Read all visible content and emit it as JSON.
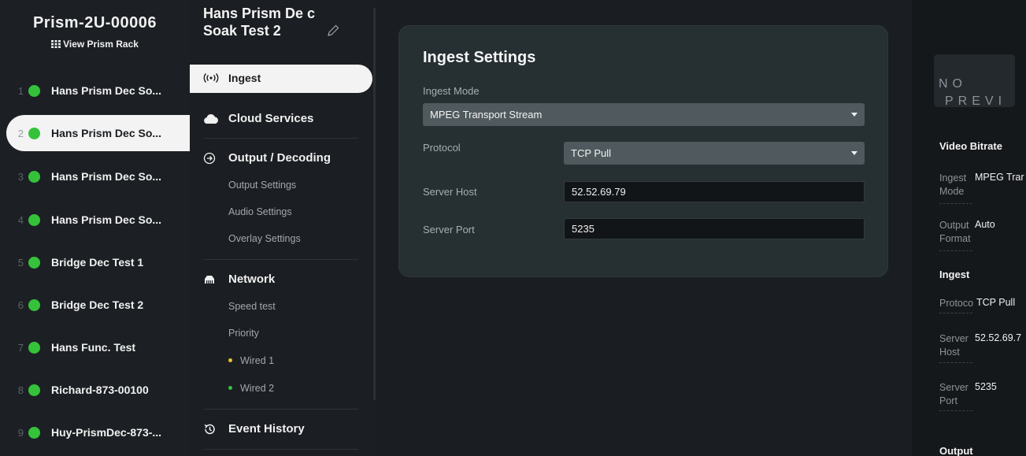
{
  "rack": {
    "title": "Prism-2U-00006",
    "view_link": "View Prism Rack",
    "devices": [
      {
        "num": "1",
        "name": "Hans Prism Dec So...",
        "active": false
      },
      {
        "num": "2",
        "name": "Hans Prism Dec So...",
        "active": true
      },
      {
        "num": "3",
        "name": "Hans Prism Dec So...",
        "active": false
      },
      {
        "num": "4",
        "name": "Hans Prism Dec So...",
        "active": false
      },
      {
        "num": "5",
        "name": "Bridge Dec Test 1",
        "active": false
      },
      {
        "num": "6",
        "name": "Bridge Dec Test 2",
        "active": false
      },
      {
        "num": "7",
        "name": "Hans Func. Test",
        "active": false
      },
      {
        "num": "8",
        "name": "Richard-873-00100",
        "active": false
      },
      {
        "num": "9",
        "name": "Huy-PrismDec-873-...",
        "active": false
      }
    ]
  },
  "nav": {
    "stream_title": "Hans Prism De c Soak Test 2",
    "ingest": "Ingest",
    "cloud": "Cloud Services",
    "output": "Output / Decoding",
    "output_settings": "Output Settings",
    "audio_settings": "Audio Settings",
    "overlay_settings": "Overlay Settings",
    "network": "Network",
    "speed_test": "Speed test",
    "priority": "Priority",
    "wired1": "Wired 1",
    "wired2": "Wired 2",
    "event_history": "Event History",
    "wired1_color": "#e8c22a",
    "wired2_color": "#35c23a"
  },
  "ingest_settings": {
    "title": "Ingest Settings",
    "mode_label": "Ingest Mode",
    "mode_value": "MPEG Transport Stream",
    "protocol_label": "Protocol",
    "protocol_value": "TCP Pull",
    "host_label": "Server Host",
    "host_value": "52.52.69.79",
    "port_label": "Server Port",
    "port_value": "5235"
  },
  "preview": {
    "line1": "NO",
    "line2": "PREVI",
    "video_bitrate": "Video Bitrate",
    "ingest_mode_key": "Ingest Mode",
    "ingest_mode_val": "MPEG Trar",
    "output_format_key": "Output Format",
    "output_format_val": "Auto",
    "ingest_header": "Ingest",
    "protocol_key": "Protoco",
    "protocol_val": "TCP Pull",
    "server_host_key": "Server Host",
    "server_host_val": "52.52.69.7",
    "server_port_key": "Server Port",
    "server_port_val": "5235",
    "output_header": "Output"
  },
  "colors": {
    "status_green": "#35c23a",
    "card_bg": "#263033",
    "select_bg": "#505a5e"
  }
}
